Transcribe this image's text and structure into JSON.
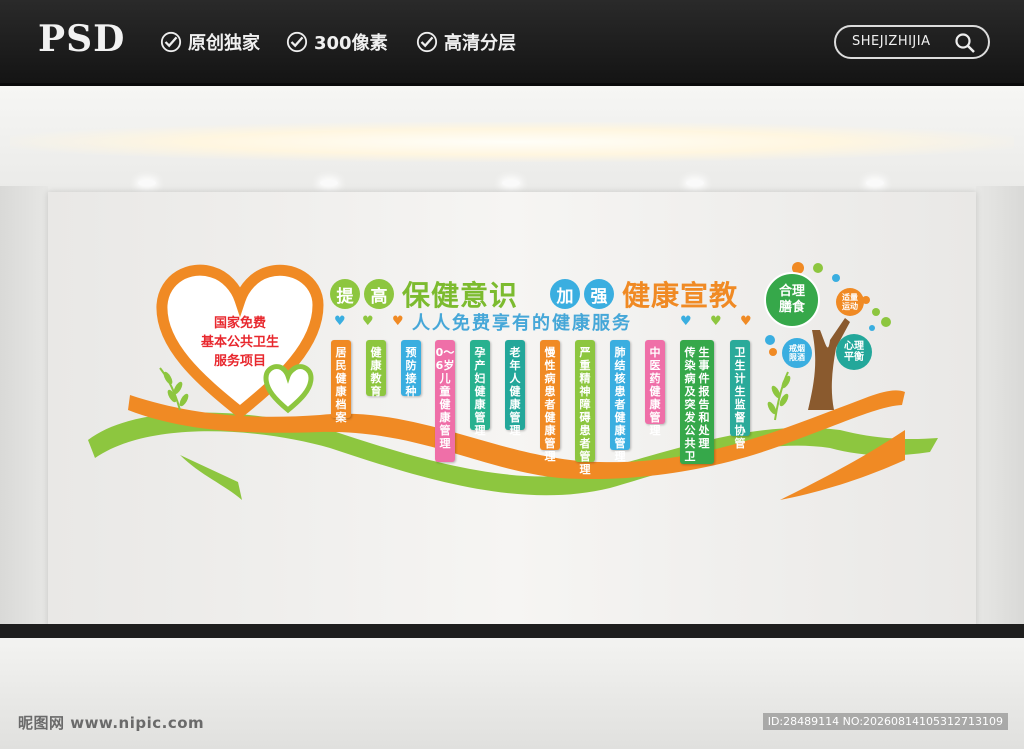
{
  "header": {
    "logo": "PSD",
    "features": [
      "原创独家",
      "300像素",
      "高清分层"
    ],
    "search_label": "SHEJIZHIJIA"
  },
  "heart": {
    "lines": [
      "国家免费",
      "基本公共卫生",
      "服务项目"
    ]
  },
  "headline": {
    "left_chars": [
      "提",
      "高"
    ],
    "left_text": "保健意识",
    "right_chars": [
      "加",
      "强"
    ],
    "right_text": "健康宣教"
  },
  "subtitle": "人人免费享有的健康服务",
  "services": [
    {
      "text": "居民健康档案",
      "color": "#f08a24"
    },
    {
      "text": "健康教育",
      "color": "#8dc63f"
    },
    {
      "text": "预防接种",
      "color": "#3aaee0"
    },
    {
      "text": "0～6岁儿童健康管理",
      "color": "#ef6fa8"
    },
    {
      "text": "孕产妇健康管理",
      "color": "#28b18f"
    },
    {
      "text": "老年人健康管理",
      "color": "#23a79a"
    },
    {
      "text": "慢性病患者健康管理",
      "color": "#f08a24"
    },
    {
      "text": "严重精神障碍患者管理",
      "color": "#8dc63f"
    },
    {
      "text": "肺结核患者健康管理",
      "color": "#3aaee0"
    },
    {
      "text": "中医药健康管理",
      "color": "#ef6fa8"
    },
    {
      "text": "传染病及突发公共卫生事件报告和处理",
      "color": "#36a84a"
    },
    {
      "text": "卫生计生监督协管",
      "color": "#2aaa9a"
    }
  ],
  "tree": {
    "main_bubble": "合理膳食",
    "bubbles": [
      "适量运动",
      "戒烟限酒",
      "心理平衡"
    ]
  },
  "footer": {
    "watermark": "昵图网 www.nipic.com",
    "id": "ID:28489114 NO:20260814105312713109"
  },
  "colors": {
    "orange": "#f08a24",
    "green": "#8dc63f",
    "blue": "#3aaee0",
    "pink": "#ef6fa8",
    "red": "#e8282e"
  }
}
